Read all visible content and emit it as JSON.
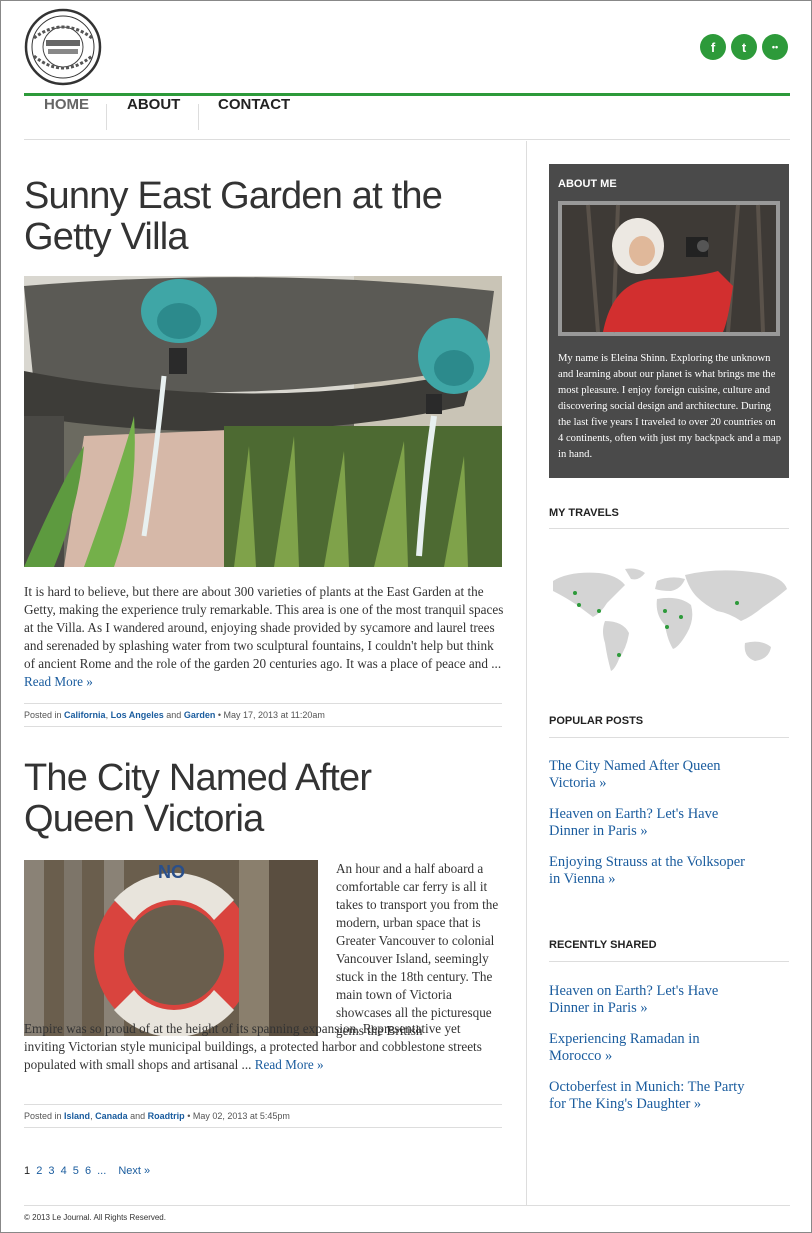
{
  "site": {
    "logo_alt": "Le Journal"
  },
  "nav": {
    "items": [
      {
        "label": "HOME"
      },
      {
        "label": "ABOUT"
      },
      {
        "label": "CONTACT"
      }
    ]
  },
  "social": [
    {
      "icon": "facebook-icon",
      "glyph": "f"
    },
    {
      "icon": "twitter-icon",
      "glyph": "t"
    },
    {
      "icon": "flickr-icon",
      "glyph": "••"
    }
  ],
  "posts": [
    {
      "title_line1": "Sunny East Garden at the",
      "title_line2": "Getty Villa",
      "excerpt": "It is hard to believe, but there are about 300 varieties of plants at the East Garden at the Getty, making the experience truly remarkable. This area is one of the most tranquil spaces at the Villa. As I wandered around, enjoying shade provided by sycamore and laurel trees and serenaded by splashing water from two sculptural fountains, I couldn't help but think of ancient Rome and the role of the garden 20 centuries ago. It was a place of peace and ...",
      "read_more": "Read More »",
      "meta_prefix": "Posted in",
      "tags": [
        "California",
        "Los Angeles",
        "Garden"
      ],
      "tag_sep": ",",
      "tag_and": "and",
      "date": "• May 17, 2013 at 11:20am"
    },
    {
      "title_line1": "The City Named After",
      "title_line2": "Queen Victoria",
      "excerpt_side": "An hour and a half aboard a comfortable car ferry is all it takes to transport you from the modern, urban space that is Greater Vancouver to colonial Vancouver Island, seemingly stuck in the 18th century. The main town of Victoria showcases all the picturesque gems the British",
      "excerpt_full": "Empire was so proud of at the height of its spanning expansion. Representative yet inviting Victorian style municipal buildings, a protected harbor and cobblestone streets populated with small shops and artisanal ...",
      "read_more": "Read More »",
      "meta_prefix": "Posted in",
      "tags": [
        "Island",
        "Canada",
        "Roadtrip"
      ],
      "tag_sep": ",",
      "tag_and": "and",
      "date": "• May 02, 2013 at 5:45pm",
      "image_text": "NO"
    }
  ],
  "sidebar": {
    "about": {
      "heading": "ABOUT ME",
      "text": "My name is Eleina Shinn. Exploring the unknown and learning about our planet is what brings me the most pleasure. I enjoy foreign cuisine, culture and discovering social design and architecture. During the last five years I traveled to over 20 countries on 4 continents, often with just my backpack and a map in hand."
    },
    "travels": {
      "heading": "MY TRAVELS"
    },
    "popular": {
      "heading": "POPULAR POSTS",
      "links": [
        {
          "line1": "The City Named After Queen",
          "line2": "Victoria »"
        },
        {
          "line1": "Heaven on Earth? Let's Have",
          "line2": "Dinner in Paris »"
        },
        {
          "line1": "Enjoying Strauss at the Volksoper",
          "line2": "in Vienna »"
        }
      ]
    },
    "recent": {
      "heading": "RECENTLY SHARED",
      "links": [
        {
          "line1": "Heaven on Earth? Let's Have",
          "line2": "Dinner in Paris »"
        },
        {
          "line1": "Experiencing Ramadan in",
          "line2": "Morocco »"
        },
        {
          "line1": "Octoberfest in Munich: The Party",
          "line2": "for The King's Daughter »"
        }
      ]
    }
  },
  "pagination": {
    "pages": [
      "1",
      "2",
      "3",
      "4",
      "5",
      "6"
    ],
    "ellipsis": "...",
    "next": "Next »"
  },
  "footer": {
    "copyright": "© 2013 Le Journal. All Rights Reserved."
  },
  "colors": {
    "accent_green": "#2d9a3a",
    "link_blue": "#1a5c9e",
    "about_bg": "#4a4a4a"
  }
}
